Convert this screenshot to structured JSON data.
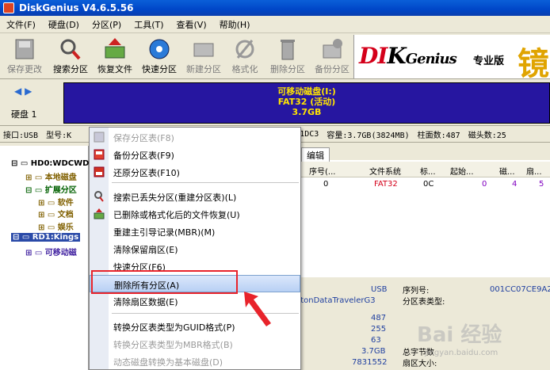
{
  "window": {
    "title": "DiskGenius V4.6.5.56"
  },
  "menu": [
    "文件(F)",
    "硬盘(D)",
    "分区(P)",
    "工具(T)",
    "查看(V)",
    "帮助(H)"
  ],
  "toolbar": [
    {
      "label": "保存更改",
      "icon": "save-icon",
      "disabled": true
    },
    {
      "label": "搜索分区",
      "icon": "search-icon",
      "disabled": false
    },
    {
      "label": "恢复文件",
      "icon": "restore-icon",
      "disabled": false
    },
    {
      "label": "快速分区",
      "icon": "quick-partition-icon",
      "disabled": false
    },
    {
      "label": "新建分区",
      "icon": "new-partition-icon",
      "disabled": true
    },
    {
      "label": "格式化",
      "icon": "format-icon",
      "disabled": true
    },
    {
      "label": "删除分区",
      "icon": "delete-icon",
      "disabled": true
    },
    {
      "label": "备份分区",
      "icon": "backup-icon",
      "disabled": true
    }
  ],
  "brand": {
    "logo_a": "DI",
    "logo_b": "K",
    "logo_c": "Genius",
    "tagline": "专业版",
    "deco": "镜"
  },
  "disk": {
    "label": "硬盘 1"
  },
  "partition_box": {
    "line1": "可移动磁盘(I:)",
    "line2": "FAT32 (活动)",
    "line3": "3.7GB"
  },
  "infobar": {
    "iface": "接口:USB",
    "model": "型号:K",
    "serial": "0A92A1DC3",
    "capacity": "容量:3.7GB(3824MB)",
    "cylinders": "柱面数:487",
    "heads": "磁头数:25"
  },
  "tree": [
    {
      "label": "HD0:WDCWD",
      "color": "#000"
    },
    {
      "label": "本地磁盘",
      "color": "#806000"
    },
    {
      "label": "扩展分区",
      "color": "#006000"
    },
    {
      "label": "软件",
      "color": "#806000"
    },
    {
      "label": "文档",
      "color": "#806000"
    },
    {
      "label": "娱乐",
      "color": "#806000"
    },
    {
      "label": "RD1:Kings",
      "color": "#fff"
    },
    {
      "label": "可移动磁",
      "color": "#4020a0"
    }
  ],
  "right_panel": {
    "tab": "编辑",
    "headers": [
      "序号(...",
      "文件系统",
      "标...",
      "起始...",
      "磁...",
      "扇..."
    ],
    "row": [
      "0",
      "FAT32",
      "0C",
      "0",
      "4",
      "5"
    ]
  },
  "details": {
    "usb": "USB",
    "serial_label": "序列号:",
    "serial_value": "001CC07CE9A2E",
    "model_value": "stonDataTravelerG3",
    "pt_type_label": "分区表类型:",
    "v1": "487",
    "v2": "255",
    "v3": "63",
    "v4": "3.7GB",
    "total_bytes_label": "总字节数",
    "v5": "7831552",
    "sector_size_label": "扇区大小:"
  },
  "context_menu": [
    {
      "label": "保存分区表(F8)",
      "disabled": true,
      "icon": "save-icon"
    },
    {
      "label": "备份分区表(F9)",
      "disabled": false,
      "icon": "backup-table-icon"
    },
    {
      "label": "还原分区表(F10)",
      "disabled": false,
      "icon": "restore-table-icon"
    },
    {
      "label": "搜索已丢失分区(重建分区表)(L)",
      "disabled": false,
      "icon": "search-icon"
    },
    {
      "label": "已删除或格式化后的文件恢复(U)",
      "disabled": false,
      "icon": "recover-icon"
    },
    {
      "label": "重建主引导记录(MBR)(M)",
      "disabled": false,
      "icon": ""
    },
    {
      "label": "清除保留扇区(E)",
      "disabled": false,
      "icon": ""
    },
    {
      "label": "快速分区(F6)",
      "disabled": false,
      "icon": ""
    },
    {
      "label": "删除所有分区(A)",
      "disabled": false,
      "icon": ""
    },
    {
      "label": "清除扇区数据(E)",
      "disabled": false,
      "icon": ""
    },
    {
      "label": "转换分区表类型为GUID格式(P)",
      "disabled": false,
      "icon": ""
    },
    {
      "label": "转换分区表类型为MBR格式(B)",
      "disabled": true,
      "icon": ""
    },
    {
      "label": "动态磁盘转换为基本磁盘(D)",
      "disabled": true,
      "icon": ""
    }
  ],
  "watermark": {
    "main": "Bai 经验",
    "sub": "jingyan.baidu.com"
  },
  "colors": {
    "title_bar": "#0046c8",
    "partition_bg": "#2616a0",
    "partition_text": "#ffe400",
    "highlight_box": "#e8232b",
    "fat32": "#d4001a"
  }
}
